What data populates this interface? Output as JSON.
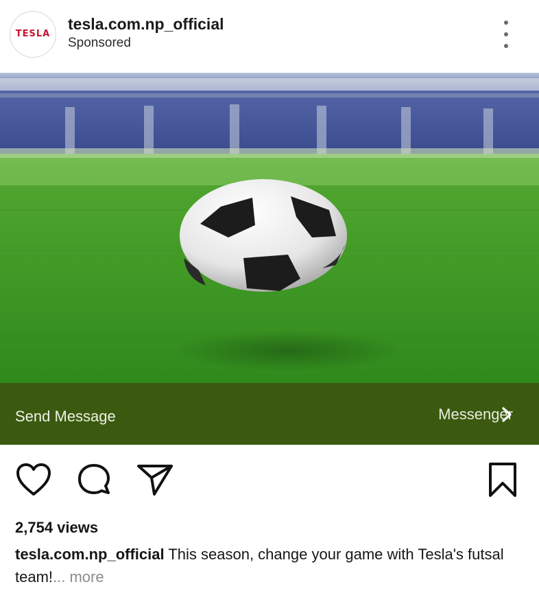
{
  "post": {
    "avatar_logo": "TESLA",
    "avatar_logo_subtext": "",
    "username": "tesla.com.np_official",
    "sponsored_label": "Sponsored",
    "more_icon": "more-vertical-icon"
  },
  "cta": {
    "left_label": "Send Message",
    "right_label": "Messenger",
    "chevron_icon": "chevron-right-icon",
    "background_color": "#3b5a10"
  },
  "actions": {
    "like_icon": "heart-icon",
    "comment_icon": "comment-icon",
    "share_icon": "send-icon",
    "save_icon": "bookmark-icon"
  },
  "stats": {
    "views": "2,754 views"
  },
  "caption": {
    "username": "tesla.com.np_official",
    "text": "This season, change your game with Tesla's futsal team!",
    "more_label": "... more"
  }
}
